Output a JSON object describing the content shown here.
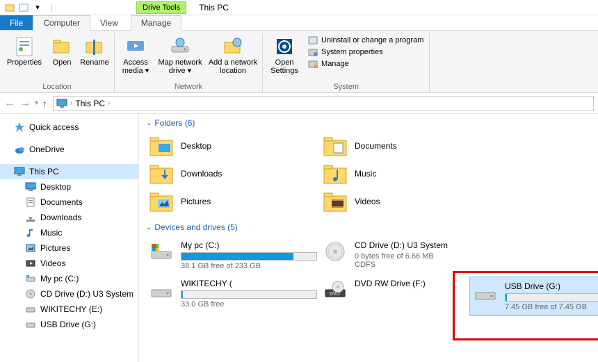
{
  "titlebar": {
    "contextual_tab": "Drive Tools",
    "window_title": "This PC"
  },
  "tabs": {
    "file": "File",
    "computer": "Computer",
    "view": "View",
    "manage": "Manage"
  },
  "ribbon": {
    "location": {
      "label": "Location",
      "properties": "Properties",
      "open": "Open",
      "rename": "Rename"
    },
    "network": {
      "label": "Network",
      "access_media": "Access media ▾",
      "map_drive": "Map network drive ▾",
      "add_location": "Add a network location"
    },
    "system": {
      "label": "System",
      "open_settings": "Open Settings",
      "uninstall": "Uninstall or change a program",
      "sys_props": "System properties",
      "manage": "Manage"
    }
  },
  "breadcrumb": {
    "root": "This PC"
  },
  "sidebar": {
    "quick_access": "Quick access",
    "onedrive": "OneDrive",
    "this_pc": "This PC",
    "desktop": "Desktop",
    "documents": "Documents",
    "downloads": "Downloads",
    "music": "Music",
    "pictures": "Pictures",
    "videos": "Videos",
    "my_pc": "My pc (C:)",
    "cd_drive": "CD Drive (D:) U3 System",
    "wikitechy": "WIKITECHY (E:)",
    "usb": "USB Drive (G:)"
  },
  "sections": {
    "folders": "Folders (6)",
    "drives": "Devices and drives (5)"
  },
  "folders": {
    "desktop": "Desktop",
    "documents": "Documents",
    "downloads": "Downloads",
    "music": "Music",
    "pictures": "Pictures",
    "videos": "Videos"
  },
  "drives": {
    "c": {
      "name": "My pc (C:)",
      "free": "38.1 GB free of 233 GB",
      "fill_pct": 83
    },
    "d": {
      "name": "CD Drive (D:) U3 System",
      "free": "0 bytes free of 6.66 MB",
      "fs": "CDFS"
    },
    "e": {
      "name": "WIKITECHY (",
      "free": "33.0 GB free"
    },
    "f": {
      "name": "DVD RW Drive (F:)"
    },
    "g": {
      "name": "USB Drive (G:)",
      "free": "7.45 GB free of 7.45 GB",
      "fill_pct": 1
    }
  }
}
